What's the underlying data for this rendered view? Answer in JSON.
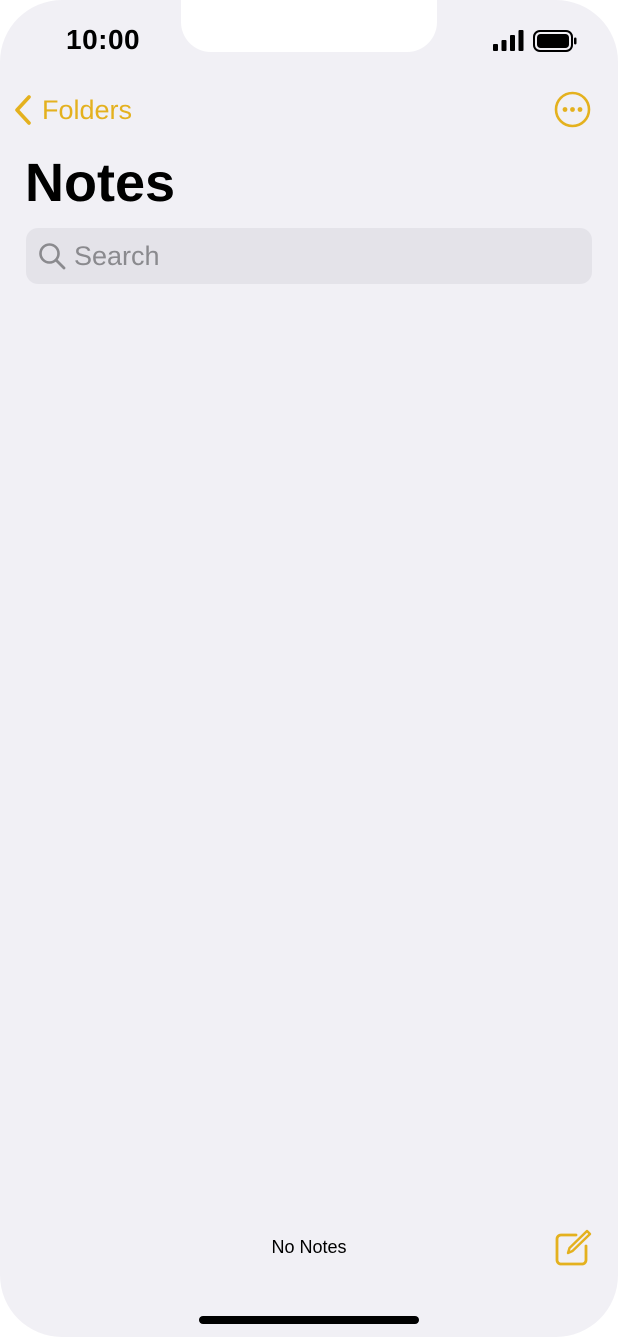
{
  "status_bar": {
    "time": "10:00",
    "signal_icon": "cellular-signal-icon",
    "battery_icon": "battery-full-icon"
  },
  "nav": {
    "back_label": "Folders",
    "back_icon": "chevron-left-icon",
    "more_icon": "ellipsis-circle-icon"
  },
  "page": {
    "title": "Notes"
  },
  "search": {
    "placeholder": "Search",
    "value": "",
    "icon": "search-icon"
  },
  "toolbar": {
    "note_count": "No Notes",
    "compose_icon": "compose-icon"
  },
  "colors": {
    "accent": "#e4b11e",
    "background": "#f1f0f5",
    "search_field": "#e4e3e9",
    "placeholder": "#8a8a8e"
  }
}
